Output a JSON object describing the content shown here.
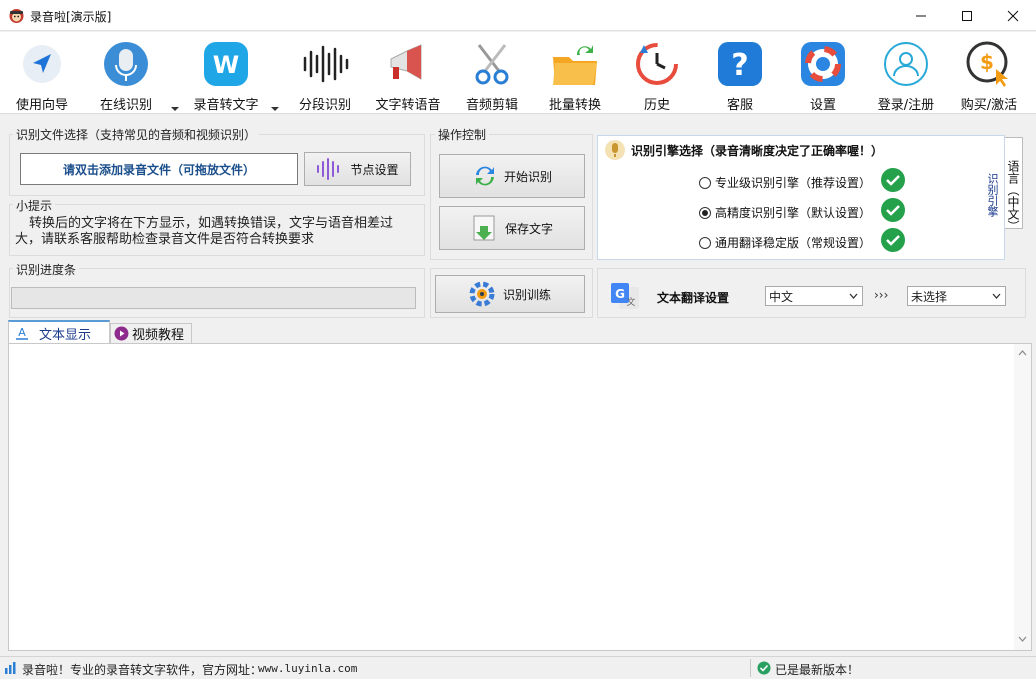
{
  "window": {
    "title": "录音啦[演示版]"
  },
  "toolbar": [
    {
      "label": "使用向导",
      "icon": "navigation-arrow-icon"
    },
    {
      "label": "在线识别",
      "icon": "microphone-icon"
    },
    {
      "label": "录音转文字",
      "icon": "w-badge-icon"
    },
    {
      "label": "分段识别",
      "icon": "waveform-icon"
    },
    {
      "label": "文字转语音",
      "icon": "megaphone-icon"
    },
    {
      "label": "音频剪辑",
      "icon": "scissors-icon"
    },
    {
      "label": "批量转换",
      "icon": "folder-sync-icon"
    },
    {
      "label": "历史",
      "icon": "history-clock-icon"
    },
    {
      "label": "客服",
      "icon": "help-question-icon"
    },
    {
      "label": "设置",
      "icon": "lifebuoy-settings-icon"
    },
    {
      "label": "登录/注册",
      "icon": "user-login-icon"
    },
    {
      "label": "购买/激活",
      "icon": "dollar-cursor-icon"
    }
  ],
  "file_select": {
    "title": "识别文件选择（支持常见的音频和视频识别）",
    "add_file_label": "请双击添加录音文件（可拖放文件）",
    "node_settings_label": "节点设置"
  },
  "hint": {
    "title": "小提示",
    "text": "转换后的文字将在下方显示，如遇转换错误，文字与语音相差过大，请联系客服帮助检查录音文件是否符合转换要求"
  },
  "progress": {
    "title": "识别进度条",
    "value": 0
  },
  "operations": {
    "title": "操作控制",
    "start_label": "开始识别",
    "save_label": "保存文字",
    "train_label": "识别训练"
  },
  "engine": {
    "title": "识别引擎选择（录音清晰度决定了正确率喔！）",
    "options": [
      {
        "label": "专业级识别引擎（推荐设置）",
        "selected": false
      },
      {
        "label": "高精度识别引擎（默认设置）",
        "selected": true
      },
      {
        "label": "通用翻译稳定版（常规设置）",
        "selected": false
      }
    ],
    "vertical_label": "识别引擎",
    "side_tab_label": "语言（中文）"
  },
  "translate": {
    "label": "文本翻译设置",
    "source": "中文",
    "arrows": "›››",
    "target": "未选择"
  },
  "tabs": [
    {
      "label": "文本显示",
      "active": true
    },
    {
      "label": "视频教程",
      "active": false
    }
  ],
  "status": {
    "left_text": "录音啦！专业的录音转文字软件，官方网址：",
    "url": "www.luyinla.com",
    "right_text": "已是最新版本！"
  },
  "colors": {
    "accent": "#1b4f8c",
    "check": "#24a14a",
    "tab_accent": "#5b9bd5"
  }
}
